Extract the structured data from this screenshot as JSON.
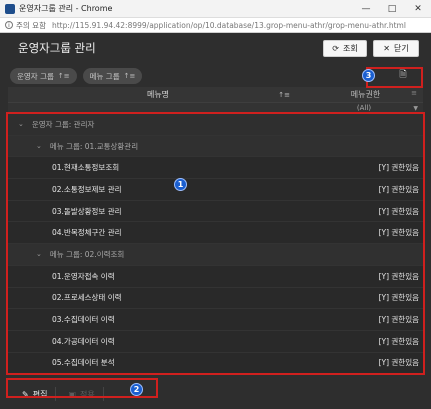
{
  "window": {
    "title": "운영자그룹 관리 - Chrome",
    "minimize_icon": "minimize-icon",
    "maximize_icon": "maximize-icon",
    "close_icon": "close-icon"
  },
  "address": {
    "security_warning": "주의 요함",
    "url": "http://115.91.94.42:8999/application/op/10.database/13.grop-menu-athr/grop-menu-athr.html"
  },
  "header": {
    "title": "운영자그룹 관리",
    "search_label": "조회",
    "close_label": "닫기"
  },
  "group_bar": {
    "chips": [
      {
        "label": "운영자 그룹"
      },
      {
        "label": "메뉴 그룹"
      }
    ]
  },
  "grid": {
    "columns": [
      "메뉴명",
      "메뉴권한"
    ],
    "filter_value": "(All)",
    "groups": [
      {
        "label": "운영자 그룹: 관리자",
        "subgroups": [
          {
            "label": "메뉴 그룹: 01.교통상황관리",
            "rows": [
              {
                "name": "01.현재소통정보조회",
                "perm": "[Y] 권한있음"
              },
              {
                "name": "02.소통정보제보 관리",
                "perm": "[Y] 권한있음"
              },
              {
                "name": "03.돌발상황정보 관리",
                "perm": "[Y] 권한있음"
              },
              {
                "name": "04.반복정체구간 관리",
                "perm": "[Y] 권한있음"
              }
            ]
          },
          {
            "label": "메뉴 그룹: 02.이력조회",
            "rows": [
              {
                "name": "01.운영자접속 이력",
                "perm": "[Y] 권한있음"
              },
              {
                "name": "02.프로세스상태 이력",
                "perm": "[Y] 권한있음"
              },
              {
                "name": "03.수집데이터 이력",
                "perm": "[Y] 권한있음"
              },
              {
                "name": "04.가공데이터 이력",
                "perm": "[Y] 권한있음"
              },
              {
                "name": "05.수집데이터 분석",
                "perm": "[Y] 권한있음"
              }
            ]
          }
        ]
      }
    ]
  },
  "footer": {
    "edit_label": "편집",
    "apply_label": "적용"
  },
  "annotations": {
    "badge1": "1",
    "badge2": "2",
    "badge3": "3",
    "box_color": "#d0201e",
    "badge_color": "#1b5fd0"
  }
}
